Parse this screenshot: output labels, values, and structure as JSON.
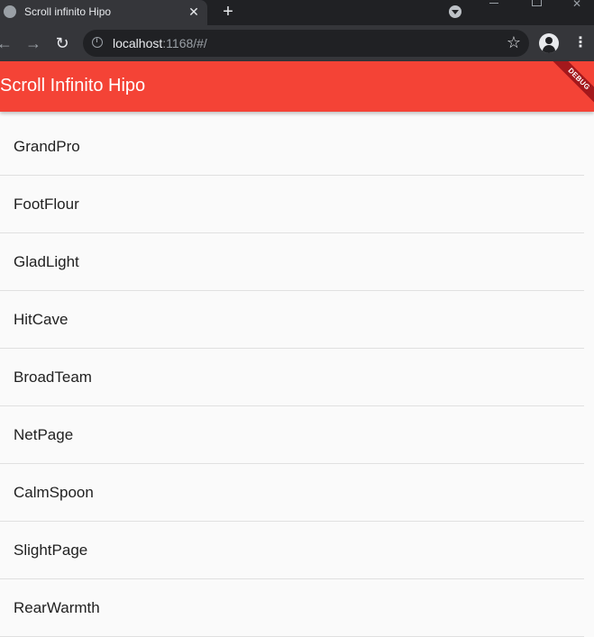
{
  "browser": {
    "tab": {
      "title": "Scroll infinito Hipo",
      "close": "✕"
    },
    "new_tab": "+",
    "url_host": "localhost",
    "url_rest": ":1168/#/",
    "nav": {
      "back": "←",
      "forward": "→",
      "reload": "↻"
    },
    "star": "☆",
    "menu": "⋮",
    "window_close": "✕"
  },
  "app": {
    "title": "Scroll Infinito Hipo",
    "debug_banner": "DEBUG",
    "appbar_color": "#f44336"
  },
  "list": {
    "items": [
      {
        "label": "GrandPro"
      },
      {
        "label": "FootFlour"
      },
      {
        "label": "GladLight"
      },
      {
        "label": "HitCave"
      },
      {
        "label": "BroadTeam"
      },
      {
        "label": "NetPage"
      },
      {
        "label": "CalmSpoon"
      },
      {
        "label": "SlightPage"
      },
      {
        "label": "RearWarmth"
      }
    ]
  }
}
